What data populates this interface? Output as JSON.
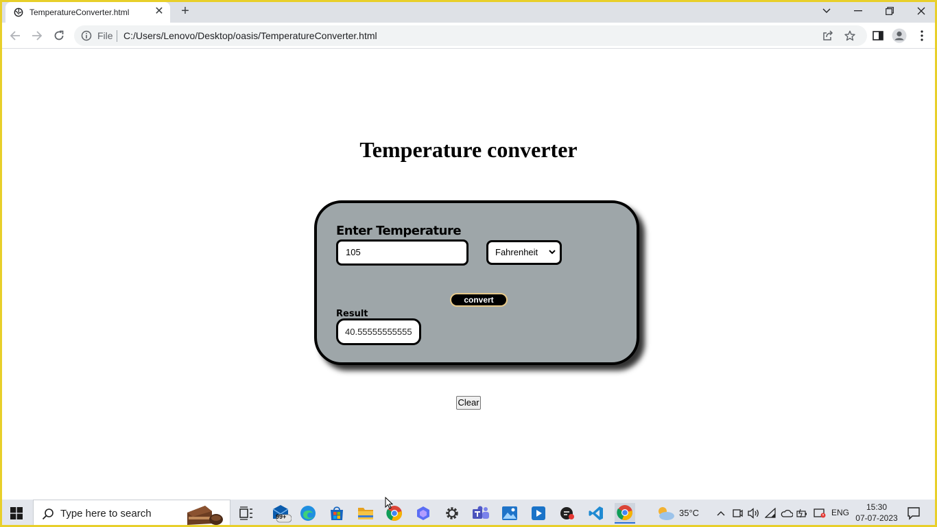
{
  "browser": {
    "tab_title": "TemperatureConverter.html",
    "address_scheme_label": "File",
    "address_url": "C:/Users/Lenovo/Desktop/oasis/TemperatureConverter.html"
  },
  "page": {
    "title": "Temperature converter",
    "enter_label": "Enter Temperature",
    "temperature_value": "105",
    "unit_selected": "Fahrenheit",
    "convert_label": "convert",
    "result_label": "Result",
    "result_value": "40.55555555555",
    "clear_label": "Clear"
  },
  "taskbar": {
    "search_placeholder": "Type here to search",
    "mail_badge": "99+",
    "weather_temp": "35°C",
    "language": "ENG",
    "time": "15:30",
    "date": "07-07-2023"
  },
  "colors": {
    "frame": "#e8cf2a",
    "card_background": "#9ea6a9",
    "card_border": "#000000",
    "convert_border": "#e7c98a"
  },
  "icons": [
    "globe-icon",
    "close-icon",
    "plus-icon",
    "back-icon",
    "forward-icon",
    "reload-icon",
    "info-icon",
    "share-icon",
    "star-icon",
    "side-panel-icon",
    "profile-icon",
    "menu-icon",
    "windows-start-icon",
    "search-icon",
    "task-view-icon",
    "mail-icon",
    "edge-icon",
    "store-icon",
    "file-explorer-icon",
    "chrome-icon",
    "settings-icon",
    "teams-icon",
    "photos-icon",
    "media-player-icon",
    "vscode-icon",
    "weather-icon",
    "chevron-up-icon",
    "wifi-icon",
    "volume-icon",
    "onedrive-icon",
    "battery-icon",
    "notification-icon"
  ]
}
